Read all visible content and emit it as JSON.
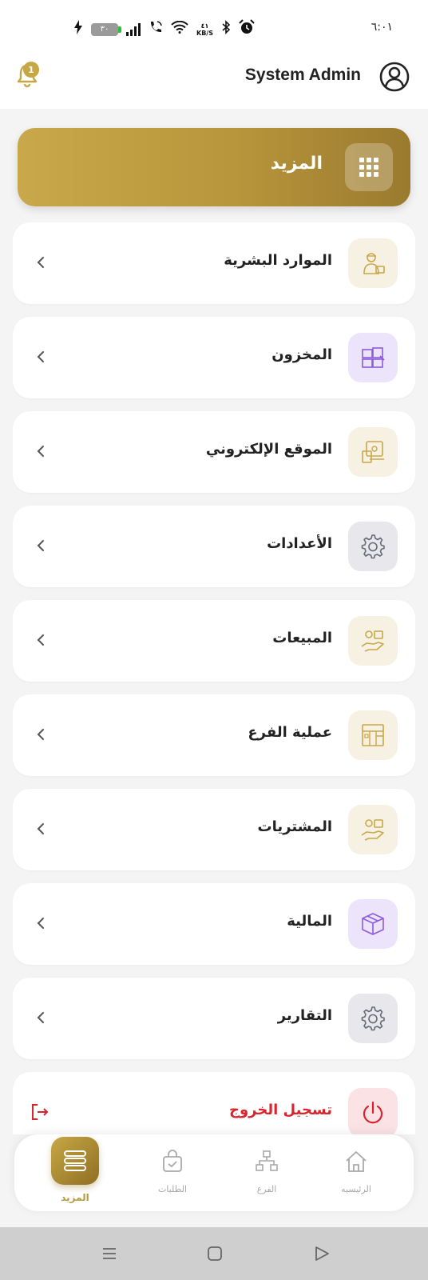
{
  "status_bar": {
    "time": "٦:٠١",
    "battery_level": "٣٠",
    "network_speed_value": "٤١",
    "network_speed_unit": "KB/S",
    "icons": [
      "charging-icon",
      "battery-icon",
      "signal-icon",
      "call-wifi-icon",
      "wifi-icon",
      "network-speed-icon",
      "bluetooth-icon",
      "alarm-icon"
    ]
  },
  "header": {
    "user_name": "System Admin",
    "notification_count": "1"
  },
  "more_banner": {
    "title": "المزيد",
    "icon": "grid-icon"
  },
  "menu": {
    "items": [
      {
        "label": "الموارد البشرية",
        "icon": "hr-person-icon",
        "icon_color": "#c9a849"
      },
      {
        "label": "المخزون",
        "icon": "inventory-boxes-icon",
        "icon_color": "#8e5bdc"
      },
      {
        "label": "الموقع الإلكتروني",
        "icon": "website-icon",
        "icon_color": "#c9a849"
      },
      {
        "label": "الأعدادات",
        "icon": "settings-gear-icon",
        "icon_color": "#666a75"
      },
      {
        "label": "المبيعات",
        "icon": "sales-hand-icon",
        "icon_color": "#c9a849"
      },
      {
        "label": "عملية الفرع",
        "icon": "branch-operation-icon",
        "icon_color": "#c9a849"
      },
      {
        "label": "المشتريات",
        "icon": "purchases-hand-icon",
        "icon_color": "#c9a849"
      },
      {
        "label": "المالية",
        "icon": "finance-box-icon",
        "icon_color": "#8e5bdc"
      },
      {
        "label": "التقارير",
        "icon": "reports-gear-icon",
        "icon_color": "#666a75"
      },
      {
        "label": "تسجيل الخروج",
        "icon": "power-icon",
        "icon_color": "#d9232d"
      }
    ]
  },
  "bottom_nav": {
    "items": [
      {
        "label": "المزيد",
        "icon": "menu-stack-icon",
        "active": true
      },
      {
        "label": "الطلبات",
        "icon": "shopping-bag-icon",
        "active": false
      },
      {
        "label": "الفرع",
        "icon": "branch-network-icon",
        "active": false
      },
      {
        "label": "الرئيسيه",
        "icon": "home-icon",
        "active": false
      }
    ]
  },
  "system_nav": {
    "icons": [
      "recents-icon",
      "home-square-icon",
      "back-triangle-icon"
    ]
  },
  "colors": {
    "accent_gold": "#c7a745",
    "logout_red": "#d9232d",
    "background": "#f4f4f4"
  }
}
